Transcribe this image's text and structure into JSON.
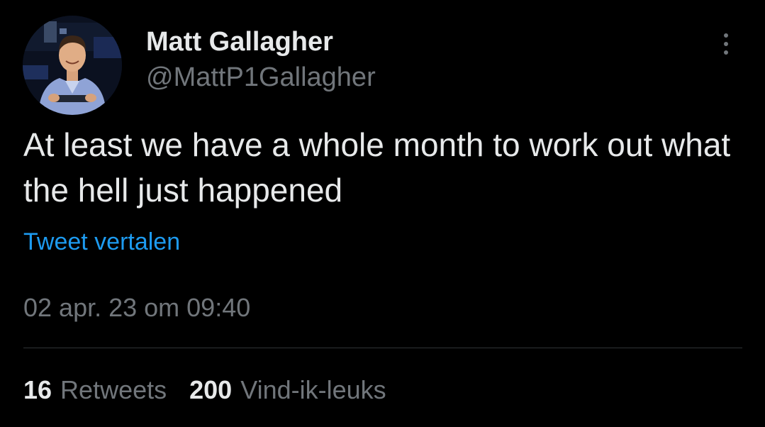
{
  "tweet": {
    "author": {
      "display_name": "Matt Gallagher",
      "handle": "@MattP1Gallagher"
    },
    "text": "At least we have a whole month to work out what the hell just happened",
    "translate_label": "Tweet vertalen",
    "timestamp": "02 apr. 23 om 09:40",
    "more_icon": "more-vertical-icon"
  },
  "stats": {
    "retweets": {
      "count": "16",
      "label": "Retweets"
    },
    "likes": {
      "count": "200",
      "label": "Vind-ik-leuks"
    }
  },
  "colors": {
    "background": "#000000",
    "text_primary": "#e7e9ea",
    "text_secondary": "#71767b",
    "link": "#1d9bf0",
    "divider": "#2f3336"
  }
}
